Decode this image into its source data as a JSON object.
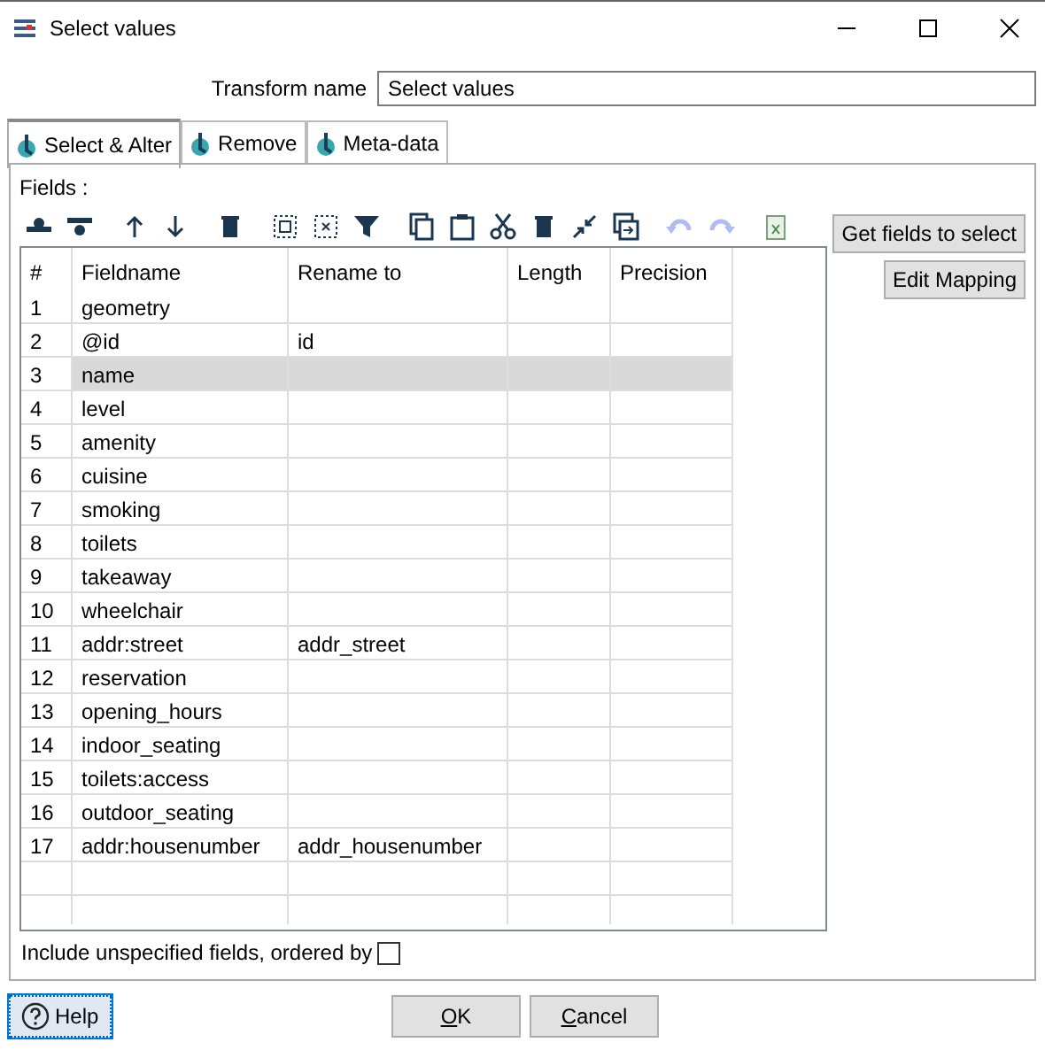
{
  "window": {
    "title": "Select values"
  },
  "transform_name": {
    "label": "Transform name",
    "value": "Select values"
  },
  "tabs": [
    {
      "label": "Select & Alter",
      "selected": true
    },
    {
      "label": "Remove",
      "selected": false
    },
    {
      "label": "Meta-data",
      "selected": false
    }
  ],
  "fields_label": "Fields :",
  "toolbar": [
    {
      "disabled": false
    },
    {
      "disabled": false
    },
    {
      "disabled": false
    },
    {
      "disabled": false
    },
    {
      "disabled": false
    },
    {
      "disabled": false
    },
    {
      "disabled": false
    },
    {
      "disabled": false
    },
    {
      "disabled": false
    },
    {
      "disabled": false
    },
    {
      "disabled": false
    },
    {
      "disabled": false
    },
    {
      "disabled": false
    },
    {
      "disabled": false
    },
    {
      "disabled": true
    },
    {
      "disabled": true
    },
    {
      "disabled": false
    }
  ],
  "table": {
    "columns": [
      "#",
      "Fieldname",
      "Rename to",
      "Length",
      "Precision"
    ],
    "rows": [
      {
        "cells": [
          "1",
          "geometry",
          "",
          "",
          ""
        ],
        "selected": false
      },
      {
        "cells": [
          "2",
          "@id",
          "id",
          "",
          ""
        ],
        "selected": false
      },
      {
        "cells": [
          "3",
          "name",
          "",
          "",
          ""
        ],
        "selected": true
      },
      {
        "cells": [
          "4",
          "level",
          "",
          "",
          ""
        ],
        "selected": false
      },
      {
        "cells": [
          "5",
          "amenity",
          "",
          "",
          ""
        ],
        "selected": false
      },
      {
        "cells": [
          "6",
          "cuisine",
          "",
          "",
          ""
        ],
        "selected": false
      },
      {
        "cells": [
          "7",
          "smoking",
          "",
          "",
          ""
        ],
        "selected": false
      },
      {
        "cells": [
          "8",
          "toilets",
          "",
          "",
          ""
        ],
        "selected": false
      },
      {
        "cells": [
          "9",
          "takeaway",
          "",
          "",
          ""
        ],
        "selected": false
      },
      {
        "cells": [
          "10",
          "wheelchair",
          "",
          "",
          ""
        ],
        "selected": false
      },
      {
        "cells": [
          "11",
          "addr:street",
          "addr_street",
          "",
          ""
        ],
        "selected": false
      },
      {
        "cells": [
          "12",
          "reservation",
          "",
          "",
          ""
        ],
        "selected": false
      },
      {
        "cells": [
          "13",
          "opening_hours",
          "",
          "",
          ""
        ],
        "selected": false
      },
      {
        "cells": [
          "14",
          "indoor_seating",
          "",
          "",
          ""
        ],
        "selected": false
      },
      {
        "cells": [
          "15",
          "toilets:access",
          "",
          "",
          ""
        ],
        "selected": false
      },
      {
        "cells": [
          "16",
          "outdoor_seating",
          "",
          "",
          ""
        ],
        "selected": false
      },
      {
        "cells": [
          "17",
          "addr:housenumber",
          "addr_housenumber",
          "",
          ""
        ],
        "selected": false
      }
    ]
  },
  "side_buttons": [
    "Get fields to select",
    "Edit Mapping"
  ],
  "include_unspecified": {
    "label": "Include unspecified fields, ordered by",
    "checked": false
  },
  "buttons": {
    "help": "Help",
    "ok": "OK",
    "cancel": "Cancel"
  }
}
